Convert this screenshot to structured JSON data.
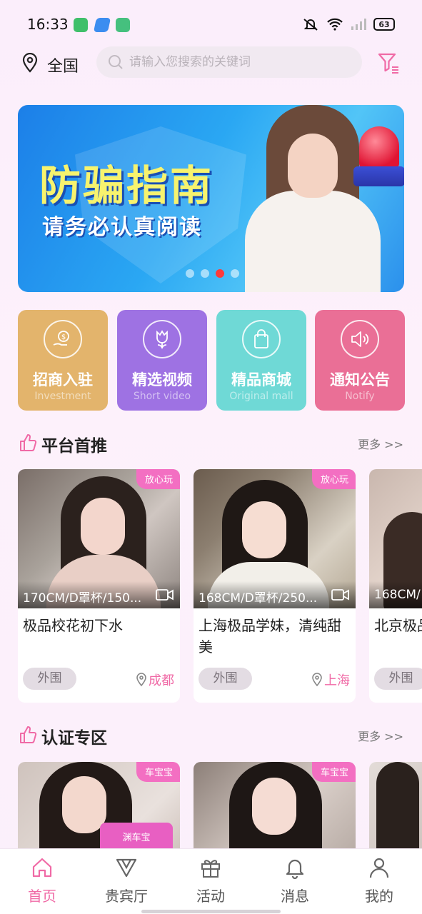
{
  "status_bar": {
    "time": "16:33",
    "battery": "63"
  },
  "header": {
    "location": "全国",
    "search_placeholder": "请输入您搜索的关键词"
  },
  "banner": {
    "title": "防骗指南",
    "subtitle": "请务必认真阅读",
    "dot_count": 4,
    "active_dot": 3
  },
  "categories": [
    {
      "title": "招商入驻",
      "subtitle": "Investment",
      "color": "#e3b46c",
      "icon": "money-hand-icon"
    },
    {
      "title": "精选视频",
      "subtitle": "Short video",
      "color": "#9e72e3",
      "icon": "tulip-icon"
    },
    {
      "title": "精品商城",
      "subtitle": "Original mall",
      "color": "#6fd9d6",
      "icon": "shopping-bag-icon"
    },
    {
      "title": "通知公告",
      "subtitle": "Notify",
      "color": "#ea6f96",
      "icon": "speaker-icon"
    }
  ],
  "sections": {
    "recommend": {
      "title": "平台首推",
      "more": "更多 >>",
      "cards": [
        {
          "tag": "放心玩",
          "caption": "170CM/D罩杯/150...",
          "name": "极品校花初下水",
          "badge": "外围",
          "city": "成都"
        },
        {
          "tag": "放心玩",
          "caption": "168CM/D罩杯/250...",
          "name": "上海极品学妹，清纯甜美",
          "badge": "外围",
          "city": "上海"
        },
        {
          "tag": "",
          "caption": "168CM/",
          "name": "北京极品水，B紧",
          "badge": "外围",
          "city": ""
        }
      ]
    },
    "verified": {
      "title": "认证专区",
      "more": "更多 >>",
      "cards": [
        {
          "tag": "车宝宝",
          "sign": "渊车宝"
        },
        {
          "tag": "车宝宝"
        },
        {
          "tag": ""
        }
      ]
    }
  },
  "tabbar": [
    {
      "label": "首页",
      "icon": "home-icon",
      "active": true
    },
    {
      "label": "贵宾厅",
      "icon": "v-icon",
      "active": false
    },
    {
      "label": "活动",
      "icon": "gift-icon",
      "active": false
    },
    {
      "label": "消息",
      "icon": "bell-icon",
      "active": false
    },
    {
      "label": "我的",
      "icon": "person-icon",
      "active": false
    }
  ],
  "colors": {
    "accent": "#f06aa6",
    "tag": "#f36fc2"
  }
}
